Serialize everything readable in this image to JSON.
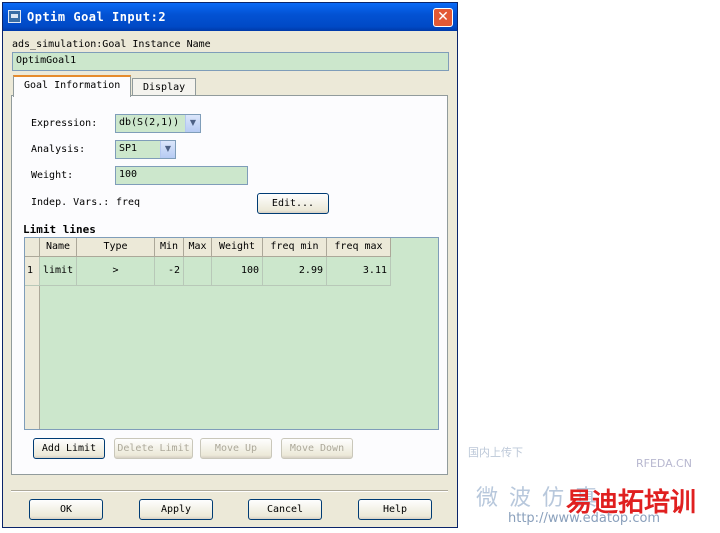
{
  "window": {
    "title": "Optim Goal Input:2",
    "close_glyph": "✕"
  },
  "instance": {
    "label": "ads_simulation:Goal Instance Name",
    "value": "OptimGoal1"
  },
  "tabs": [
    {
      "label": "Goal Information",
      "active": true
    },
    {
      "label": "Display",
      "active": false
    }
  ],
  "form": {
    "expression_label": "Expression:",
    "expression_value": "db(S(2,1))",
    "analysis_label": "Analysis:",
    "analysis_value": "SP1",
    "weight_label": "Weight:",
    "weight_value": "100",
    "indep_label": "Indep. Vars.:",
    "indep_value": "freq",
    "edit_button": "Edit..."
  },
  "limit_lines": {
    "title": "Limit lines",
    "columns": [
      "Name",
      "Type",
      "Min",
      "Max",
      "Weight",
      "freq min",
      "freq max"
    ],
    "rows": [
      {
        "index": "1",
        "name": "limit",
        "type": ">",
        "min": "-2",
        "max": "",
        "weight": "100",
        "freq_min": "2.99",
        "freq_max": "3.11"
      }
    ],
    "buttons": {
      "add": "Add Limit",
      "delete": "Delete Limit",
      "move_up": "Move Up",
      "move_down": "Move Down"
    }
  },
  "footer": {
    "ok": "OK",
    "apply": "Apply",
    "cancel": "Cancel",
    "help": "Help"
  },
  "watermark": {
    "line1": "国内上传下",
    "brand_en": "RFEDA.CN",
    "line2": "微 波 仿 真",
    "brand_cn": "易迪拓培训",
    "url": "http://www.edatop.com"
  },
  "colors": {
    "field_bg": "#cce7cc",
    "titlebar": "#0352d4",
    "active_tab_accent": "#e68b2c",
    "watermark_red": "#e02020"
  }
}
